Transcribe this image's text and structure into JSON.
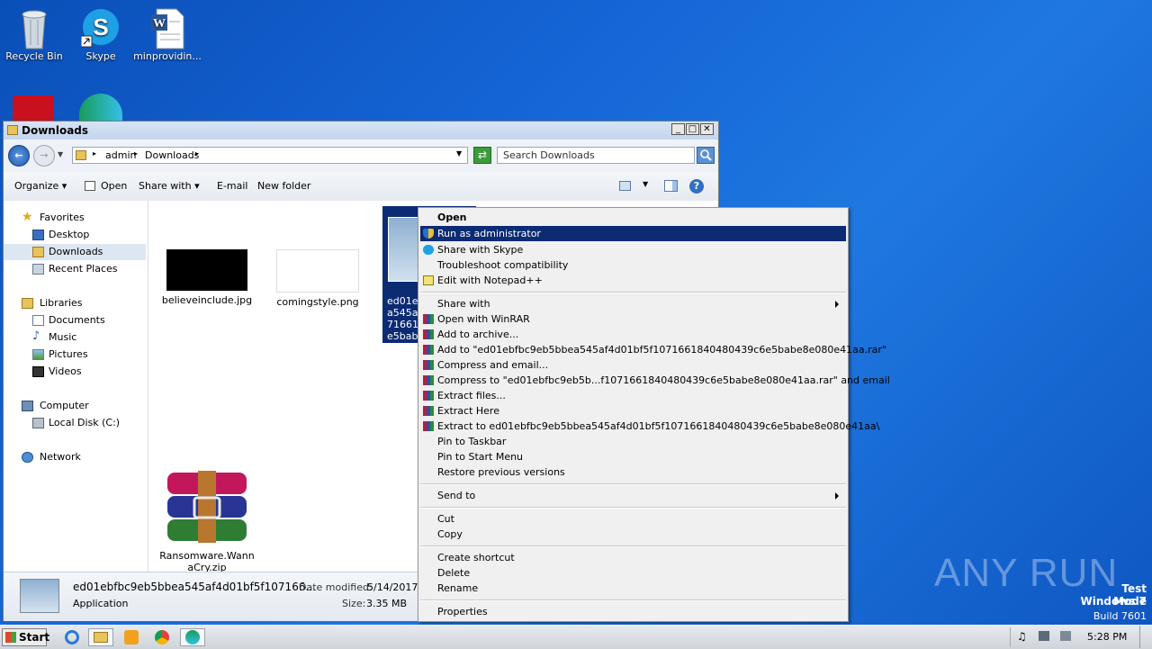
{
  "desktop": {
    "icons": [
      {
        "label": "Recycle Bin"
      },
      {
        "label": "Skype"
      },
      {
        "label": "minprovidin..."
      }
    ]
  },
  "window": {
    "title": "Downloads",
    "breadcrumb": [
      "admin",
      "Downloads"
    ],
    "search_placeholder": "Search Downloads",
    "toolbar": {
      "organize": "Organize",
      "open": "Open",
      "share_with": "Share with",
      "email": "E-mail",
      "new_folder": "New folder"
    },
    "nav": {
      "favorites": "Favorites",
      "desktop": "Desktop",
      "downloads": "Downloads",
      "recent": "Recent Places",
      "libraries": "Libraries",
      "documents": "Documents",
      "music": "Music",
      "pictures": "Pictures",
      "videos": "Videos",
      "computer": "Computer",
      "local_disk": "Local Disk (C:)",
      "network": "Network"
    },
    "files": [
      {
        "name": "believeinclude.jpg"
      },
      {
        "name": "comingstyle.png"
      },
      {
        "name_lines": [
          "ed01eb",
          "a545af",
          "716618",
          "e5babe"
        ]
      },
      {
        "name_lines": [
          "Ransomware.Wann",
          "aCry.zip"
        ]
      }
    ],
    "details": {
      "filename": "ed01ebfbc9eb5bbea545af4d01bf5f107166...",
      "type": "Application",
      "date_label": "Date modified:",
      "date_value": "5/14/2017 3",
      "size_label": "Size:",
      "size_value": "3.35 MB"
    }
  },
  "context_menu": {
    "items": [
      {
        "label": "Open",
        "bold": true
      },
      {
        "label": "Run as administrator",
        "highlight": true,
        "icon": "shield-icon"
      },
      {
        "label": "Share with Skype",
        "icon": "skype-icon"
      },
      {
        "label": "Troubleshoot compatibility"
      },
      {
        "label": "Edit with Notepad++",
        "icon": "notepad-icon"
      },
      {
        "label": "Share with",
        "submenu": true
      },
      {
        "label": "Open with WinRAR",
        "icon": "winrar-icon"
      },
      {
        "label": "Add to archive...",
        "icon": "winrar-icon"
      },
      {
        "label": "Add to \"ed01ebfbc9eb5bbea545af4d01bf5f1071661840480439c6e5babe8e080e41aa.rar\"",
        "icon": "winrar-icon"
      },
      {
        "label": "Compress and email...",
        "icon": "winrar-icon"
      },
      {
        "label": "Compress to \"ed01ebfbc9eb5b...f1071661840480439c6e5babe8e080e41aa.rar\" and email",
        "icon": "winrar-icon"
      },
      {
        "label": "Extract files...",
        "icon": "winrar-icon"
      },
      {
        "label": "Extract Here",
        "icon": "winrar-icon"
      },
      {
        "label": "Extract to ed01ebfbc9eb5bbea545af4d01bf5f1071661840480439c6e5babe8e080e41aa\\",
        "icon": "winrar-icon"
      },
      {
        "label": "Pin to Taskbar"
      },
      {
        "label": "Pin to Start Menu"
      },
      {
        "label": "Restore previous versions"
      },
      {
        "label": "Send to",
        "submenu": true
      },
      {
        "label": "Cut"
      },
      {
        "label": "Copy"
      },
      {
        "label": "Create shortcut"
      },
      {
        "label": "Delete"
      },
      {
        "label": "Rename"
      },
      {
        "label": "Properties"
      }
    ]
  },
  "watermark": {
    "brand": "ANY RUN",
    "mode": "Test Mode",
    "os": "Windows 7",
    "build": "Build 7601"
  },
  "taskbar": {
    "start": "Start",
    "clock": "5:28 PM"
  },
  "colors": {
    "highlight": "#0b2b73",
    "desktop": "#1565d6"
  }
}
